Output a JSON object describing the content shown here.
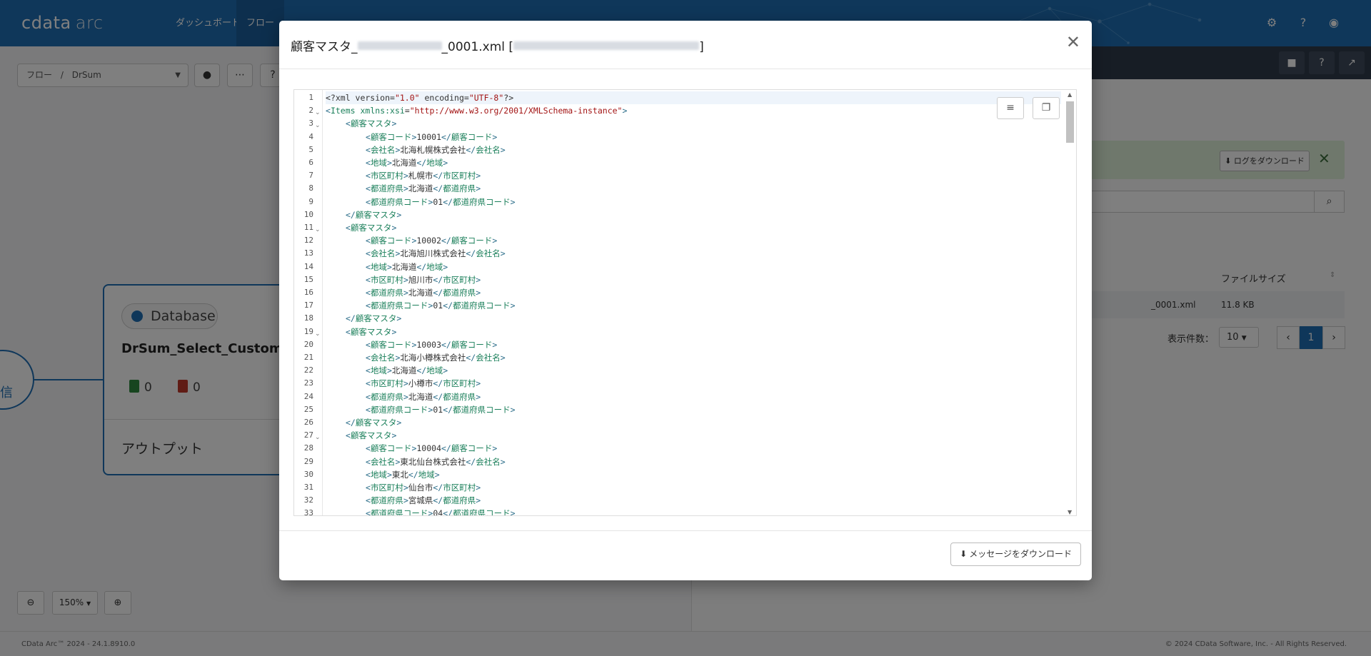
{
  "app": {
    "logo_main": "cdata",
    "logo_sub": "arc",
    "nav": [
      {
        "label": "ダッシュボード"
      },
      {
        "label": "フロー"
      }
    ],
    "icons": [
      "gear-icon",
      "help-icon",
      "user-icon"
    ]
  },
  "background": {
    "breadcrumb_root": "フロー",
    "breadcrumb_sep": "/",
    "breadcrumb_current": "DrSum",
    "toolbar_buttons": [
      "user-icon",
      "more-icon",
      "help-icon"
    ],
    "right_header_buttons": [
      "trash-icon",
      "help-icon",
      "external-link-icon"
    ],
    "log_download_label": "ログをダウンロード",
    "file_column_header": "ファイルサイズ",
    "file_row_name": "_0001.xml",
    "file_row_size": "11.8 KB",
    "page_size_label": "表示件数：",
    "page_size_value": "10",
    "current_page": "1",
    "node": {
      "badge": "Database",
      "title": "DrSum_Select_Customer",
      "success_count": "0",
      "error_count": "0",
      "output_label": "アウトプット"
    },
    "left_node_label": "信",
    "zoom_level": "150%",
    "footer_left": "CData Arc™ 2024 - 24.1.8910.0",
    "footer_right": "© 2024 CData Software, Inc. - All Rights Reserved."
  },
  "modal": {
    "title_prefix": "顧客マスタ_",
    "title_suffix": "_0001.xml [",
    "title_end": "]",
    "download_label": "メッセージをダウンロード",
    "lines": [
      {
        "n": "1",
        "fold": false,
        "indent": 0,
        "text": "<?xml version=\"1.0\" encoding=\"UTF-8\"?>",
        "kind": "decl"
      },
      {
        "n": "2",
        "fold": true,
        "indent": 0,
        "text": "<Items xmlns:xsi=\"http://www.w3.org/2001/XMLSchema-instance\">",
        "kind": "root"
      },
      {
        "n": "3",
        "fold": true,
        "indent": 1,
        "text": "<顧客マスタ>",
        "kind": "tag"
      },
      {
        "n": "4",
        "fold": false,
        "indent": 2,
        "text": "<顧客コード>10001</顧客コード>",
        "kind": "tag"
      },
      {
        "n": "5",
        "fold": false,
        "indent": 2,
        "text": "<会社名>北海札幌株式会社</会社名>",
        "kind": "tag"
      },
      {
        "n": "6",
        "fold": false,
        "indent": 2,
        "text": "<地域>北海道</地域>",
        "kind": "tag"
      },
      {
        "n": "7",
        "fold": false,
        "indent": 2,
        "text": "<市区町村>札幌市</市区町村>",
        "kind": "tag"
      },
      {
        "n": "8",
        "fold": false,
        "indent": 2,
        "text": "<都道府県>北海道</都道府県>",
        "kind": "tag"
      },
      {
        "n": "9",
        "fold": false,
        "indent": 2,
        "text": "<都道府県コード>01</都道府県コード>",
        "kind": "tag"
      },
      {
        "n": "10",
        "fold": false,
        "indent": 1,
        "text": "</顧客マスタ>",
        "kind": "tag"
      },
      {
        "n": "11",
        "fold": true,
        "indent": 1,
        "text": "<顧客マスタ>",
        "kind": "tag"
      },
      {
        "n": "12",
        "fold": false,
        "indent": 2,
        "text": "<顧客コード>10002</顧客コード>",
        "kind": "tag"
      },
      {
        "n": "13",
        "fold": false,
        "indent": 2,
        "text": "<会社名>北海旭川株式会社</会社名>",
        "kind": "tag"
      },
      {
        "n": "14",
        "fold": false,
        "indent": 2,
        "text": "<地域>北海道</地域>",
        "kind": "tag"
      },
      {
        "n": "15",
        "fold": false,
        "indent": 2,
        "text": "<市区町村>旭川市</市区町村>",
        "kind": "tag"
      },
      {
        "n": "16",
        "fold": false,
        "indent": 2,
        "text": "<都道府県>北海道</都道府県>",
        "kind": "tag"
      },
      {
        "n": "17",
        "fold": false,
        "indent": 2,
        "text": "<都道府県コード>01</都道府県コード>",
        "kind": "tag"
      },
      {
        "n": "18",
        "fold": false,
        "indent": 1,
        "text": "</顧客マスタ>",
        "kind": "tag"
      },
      {
        "n": "19",
        "fold": true,
        "indent": 1,
        "text": "<顧客マスタ>",
        "kind": "tag"
      },
      {
        "n": "20",
        "fold": false,
        "indent": 2,
        "text": "<顧客コード>10003</顧客コード>",
        "kind": "tag"
      },
      {
        "n": "21",
        "fold": false,
        "indent": 2,
        "text": "<会社名>北海小樽株式会社</会社名>",
        "kind": "tag"
      },
      {
        "n": "22",
        "fold": false,
        "indent": 2,
        "text": "<地域>北海道</地域>",
        "kind": "tag"
      },
      {
        "n": "23",
        "fold": false,
        "indent": 2,
        "text": "<市区町村>小樽市</市区町村>",
        "kind": "tag"
      },
      {
        "n": "24",
        "fold": false,
        "indent": 2,
        "text": "<都道府県>北海道</都道府県>",
        "kind": "tag"
      },
      {
        "n": "25",
        "fold": false,
        "indent": 2,
        "text": "<都道府県コード>01</都道府県コード>",
        "kind": "tag"
      },
      {
        "n": "26",
        "fold": false,
        "indent": 1,
        "text": "</顧客マスタ>",
        "kind": "tag"
      },
      {
        "n": "27",
        "fold": true,
        "indent": 1,
        "text": "<顧客マスタ>",
        "kind": "tag"
      },
      {
        "n": "28",
        "fold": false,
        "indent": 2,
        "text": "<顧客コード>10004</顧客コード>",
        "kind": "tag"
      },
      {
        "n": "29",
        "fold": false,
        "indent": 2,
        "text": "<会社名>東北仙台株式会社</会社名>",
        "kind": "tag"
      },
      {
        "n": "30",
        "fold": false,
        "indent": 2,
        "text": "<地域>東北</地域>",
        "kind": "tag"
      },
      {
        "n": "31",
        "fold": false,
        "indent": 2,
        "text": "<市区町村>仙台市</市区町村>",
        "kind": "tag"
      },
      {
        "n": "32",
        "fold": false,
        "indent": 2,
        "text": "<都道府県>宮城県</都道府県>",
        "kind": "tag"
      },
      {
        "n": "33",
        "fold": false,
        "indent": 2,
        "text": "<都道府県コード>04</都道府県コード>",
        "kind": "tag"
      }
    ]
  }
}
